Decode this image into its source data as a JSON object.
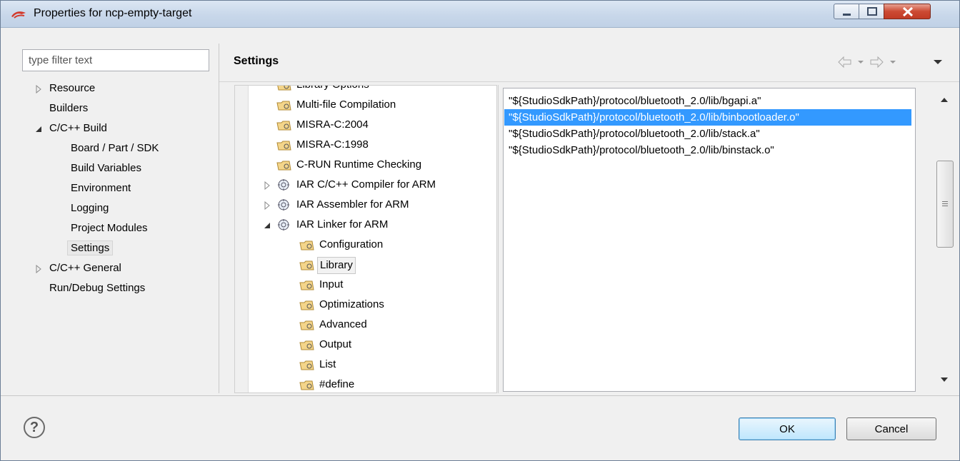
{
  "window": {
    "title": "Properties for ncp-empty-target",
    "min_glyph": "–",
    "max_glyph": "□",
    "close_glyph": "✕"
  },
  "filter": {
    "placeholder": "type filter text"
  },
  "nav": [
    {
      "label": "Resource",
      "expander": "collapsed"
    },
    {
      "label": "Builders"
    },
    {
      "label": "C/C++ Build",
      "expander": "expanded"
    },
    {
      "label": "Board / Part / SDK"
    },
    {
      "label": "Build Variables"
    },
    {
      "label": "Environment"
    },
    {
      "label": "Logging"
    },
    {
      "label": "Project Modules"
    },
    {
      "label": "Settings",
      "selected": true
    },
    {
      "label": "C/C++ General",
      "expander": "collapsed"
    },
    {
      "label": "Run/Debug Settings"
    }
  ],
  "page": {
    "title": "Settings"
  },
  "tool_tree": [
    {
      "label": "Library Options",
      "icon": "options-icon"
    },
    {
      "label": "Multi-file Compilation",
      "icon": "options-icon"
    },
    {
      "label": "MISRA-C:2004",
      "icon": "options-icon"
    },
    {
      "label": "MISRA-C:1998",
      "icon": "options-icon"
    },
    {
      "label": "C-RUN Runtime Checking",
      "icon": "options-icon"
    },
    {
      "label": "IAR C/C++ Compiler for ARM",
      "icon": "tool-icon",
      "expander": "collapsed"
    },
    {
      "label": "IAR Assembler for ARM",
      "icon": "tool-icon",
      "expander": "collapsed"
    },
    {
      "label": "IAR Linker for ARM",
      "icon": "tool-icon",
      "expander": "expanded"
    },
    {
      "label": "Configuration",
      "icon": "options-icon"
    },
    {
      "label": "Library",
      "icon": "options-icon",
      "selected": true
    },
    {
      "label": "Input",
      "icon": "options-icon"
    },
    {
      "label": "Optimizations",
      "icon": "options-icon"
    },
    {
      "label": "Advanced",
      "icon": "options-icon"
    },
    {
      "label": "Output",
      "icon": "options-icon"
    },
    {
      "label": "List",
      "icon": "options-icon"
    },
    {
      "label": "#define",
      "icon": "options-icon"
    }
  ],
  "library_list": [
    {
      "value": "\"${StudioSdkPath}/protocol/bluetooth_2.0/lib/bgapi.a\""
    },
    {
      "value": "\"${StudioSdkPath}/protocol/bluetooth_2.0/lib/binbootloader.o\"",
      "selected": true
    },
    {
      "value": "\"${StudioSdkPath}/protocol/bluetooth_2.0/lib/stack.a\""
    },
    {
      "value": "\"${StudioSdkPath}/protocol/bluetooth_2.0/lib/binstack.o\""
    }
  ],
  "buttons": {
    "help": "?",
    "ok": "OK",
    "cancel": "Cancel"
  },
  "colors": {
    "selection": "#3399ff",
    "close_button": "#c13b25"
  }
}
